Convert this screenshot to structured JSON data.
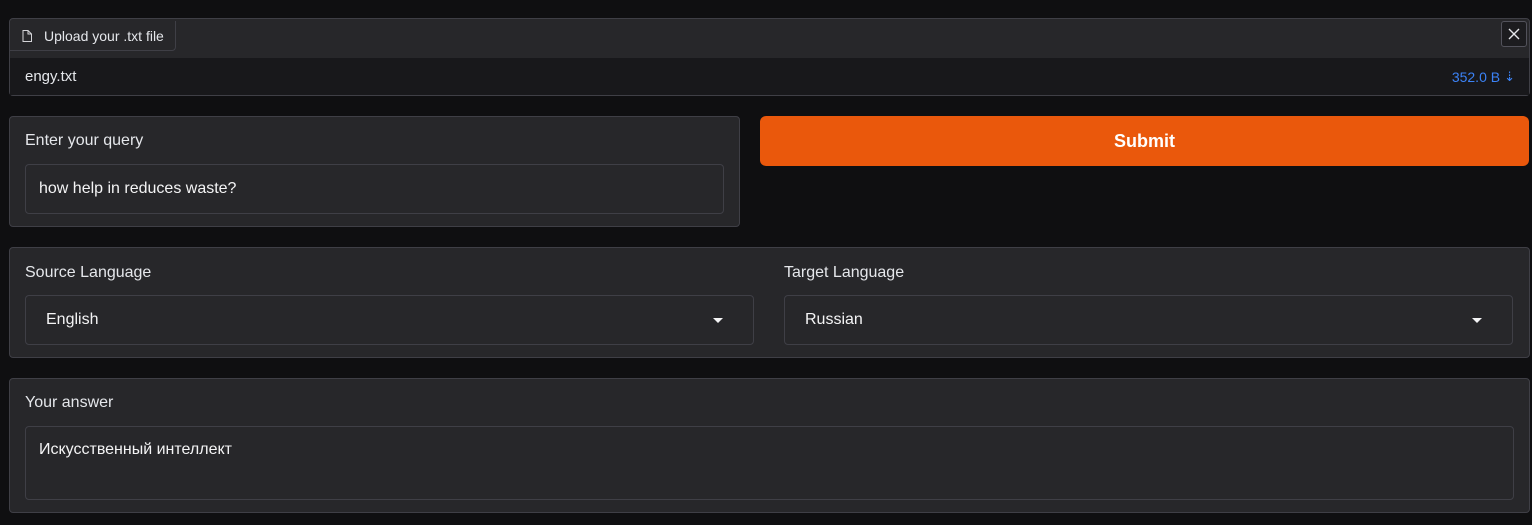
{
  "file_upload": {
    "label": "Upload your .txt file",
    "file_name": "engy.txt",
    "file_size": "352.0 B",
    "download_glyph": "⇣",
    "close_glyph": "close-icon"
  },
  "query": {
    "label": "Enter your query",
    "value": "how help in reduces waste?"
  },
  "submit": {
    "label": "Submit",
    "color": "#ea580c"
  },
  "languages": {
    "source_label": "Source Language",
    "source_value": "English",
    "target_label": "Target Language",
    "target_value": "Russian"
  },
  "answer": {
    "label": "Your answer",
    "value": "Искусственный интеллект"
  },
  "colors": {
    "background": "#0f0f11",
    "panel": "#27272a",
    "border": "#3f3f46",
    "accent_link": "#3b82f6"
  }
}
